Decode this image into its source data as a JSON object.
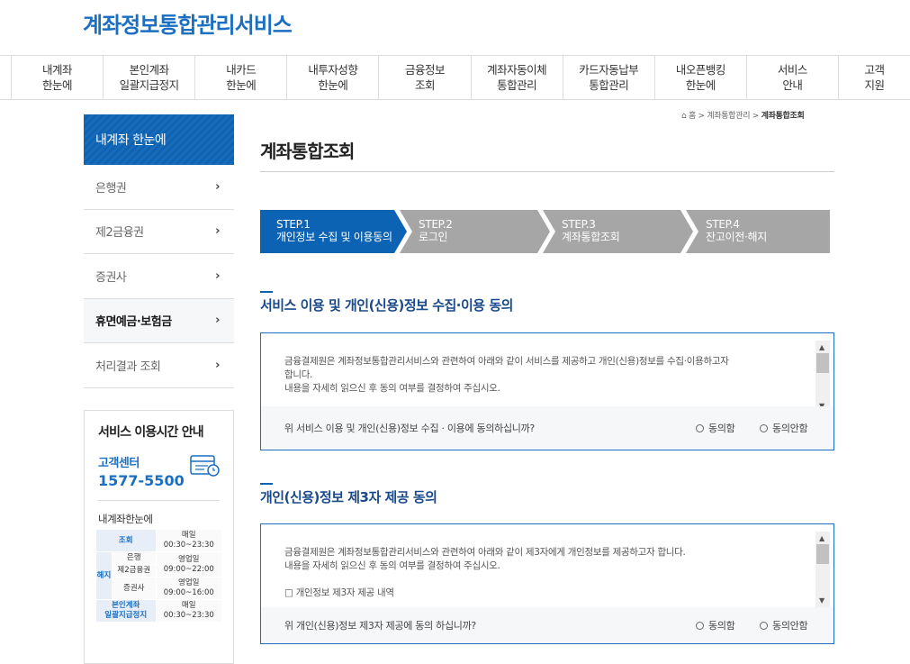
{
  "header": {
    "logo": "계좌정보통합관리서비스"
  },
  "gnb": [
    "내계좌\n한눈에",
    "본인계좌\n일괄지급정지",
    "내카드\n한눈에",
    "내투자성향\n한눈에",
    "금융정보\n조회",
    "계좌자동이체\n통합관리",
    "카드자동납부\n통합관리",
    "내오픈뱅킹\n한눈에",
    "서비스\n안내",
    "고객\n지원"
  ],
  "lnb": {
    "title": "내계좌 한눈에",
    "items": [
      "은행권",
      "제2금융권",
      "증권사",
      "휴면예금·보험금",
      "처리결과 조회"
    ],
    "active_index": 3
  },
  "service_time": {
    "title": "서비스 이용시간 안내",
    "cc_label": "고객센터",
    "cc_number": "1577-5500",
    "sub": "내계좌한눈에",
    "table": {
      "inquiry": "조회",
      "inquiry_time": "매일\n00:30~23:30",
      "cancel": "해지",
      "bank": "은행",
      "bank_time": "영업일\n09:00~22:00",
      "second": "제2금융권",
      "securities": "증권사",
      "sec_time": "영업일\n09:00~16:00",
      "stop": "본인계좌\n일괄지급정지",
      "stop_time": "매일\n00:30~23:30"
    }
  },
  "breadcrumb": {
    "home": "홈",
    "path1": "계좌통합관리",
    "current": "계좌통합조회"
  },
  "page_title": "계좌통합조회",
  "steps": [
    {
      "num": "STEP.1",
      "name": "개인정보 수집 및 이용동의"
    },
    {
      "num": "STEP.2",
      "name": "로그인"
    },
    {
      "num": "STEP.3",
      "name": "계좌통합조회"
    },
    {
      "num": "STEP.4",
      "name": "잔고이전·해지"
    }
  ],
  "section1": {
    "title": "서비스 이용 및 개인(신용)정보 수집·이용 동의",
    "text1": "금융결제원은 계좌정보통합관리서비스와 관련하여 아래와 같이 서비스를 제공하고 개인(신용)정보를 수집·이용하고자",
    "text2": "합니다.",
    "text3": "내용을 자세히 읽으신 후 동의 여부를 결정하여 주십시오.",
    "question": "위 서비스 이용 및 개인(신용)정보 수집 · 이용에 동의하십니까?",
    "agree": "동의함",
    "disagree": "동의안함"
  },
  "section2": {
    "title": "개인(신용)정보 제3자 제공 동의",
    "text1": "금융결제원은 계좌정보통합관리서비스와 관련하여 아래와 같이 제3자에게 개인정보를 제공하고자 합니다.",
    "text2": "내용을 자세히 읽으신 후 동의 여부를 결정하여 주십시오.",
    "text3": "□ 개인정보 제3자 제공 내역",
    "question": "위 개인(신용)정보 제3자 제공에 동의 하십니까?",
    "agree": "동의함",
    "disagree": "동의안함"
  }
}
